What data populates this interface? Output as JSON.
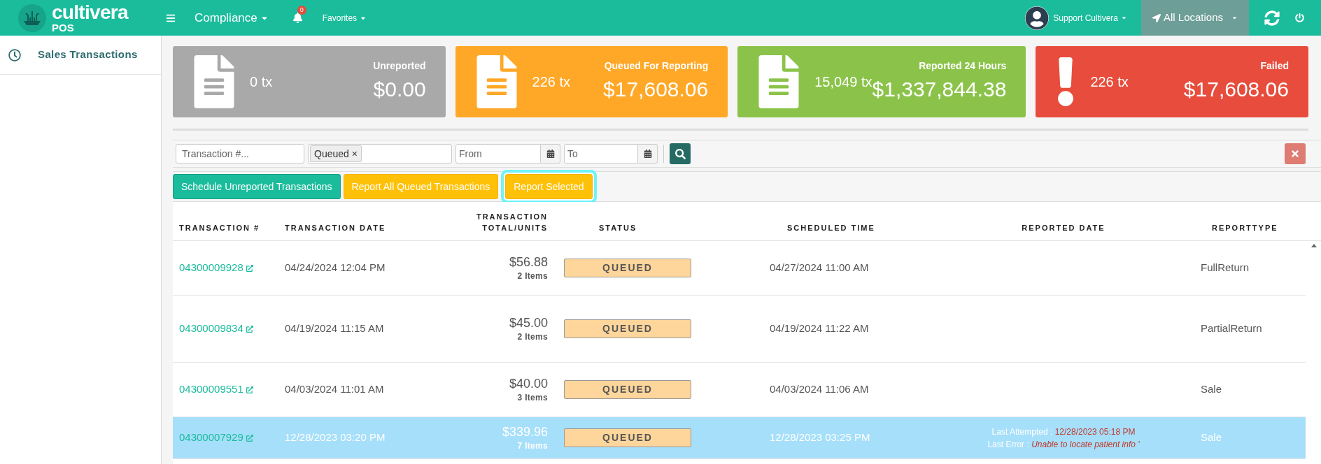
{
  "topbar": {
    "brand": "cultivera",
    "brand_sub": "POS",
    "menu": "Compliance",
    "notifications": "0",
    "favorites": "Favorites",
    "user": "Support Cultivera",
    "location": "All Locations"
  },
  "sidebar": {
    "items": [
      {
        "label": "Sales Transactions",
        "selected": true
      }
    ]
  },
  "cards": [
    {
      "label": "Unreported",
      "count": "0 tx",
      "amount": "$0.00",
      "kind": "document",
      "color": "#a9a9a9"
    },
    {
      "label": "Queued For Reporting",
      "count": "226 tx",
      "amount": "$17,608.06",
      "kind": "document",
      "color": "#ffa726"
    },
    {
      "label": "Reported 24 Hours",
      "count": "15,049 tx",
      "amount": "$1,337,844.38",
      "kind": "document",
      "color": "#8bc34a"
    },
    {
      "label": "Failed",
      "count": "226 tx",
      "amount": "$17,608.06",
      "kind": "alert",
      "color": "#e74c3c"
    }
  ],
  "filters": {
    "transaction_placeholder": "Transaction #...",
    "status_tag": "Queued",
    "tag_remove": "×",
    "from_placeholder": "From",
    "to_placeholder": "To"
  },
  "actions": [
    {
      "label": "Schedule Unreported Transactions",
      "kind": "primary",
      "focused": false
    },
    {
      "label": "Report All Queued Transactions",
      "kind": "warning",
      "focused": false
    },
    {
      "label": "Report Selected",
      "kind": "warning",
      "focused": true
    }
  ],
  "table": {
    "columns": [
      "TRANSACTION #",
      "TRANSACTION DATE",
      "TRANSACTION TOTAL/UNITS",
      "STATUS",
      "SCHEDULED TIME",
      "REPORTED DATE",
      "REPORTTYPE"
    ],
    "rows": [
      {
        "transaction": "04300009928",
        "date": "04/24/2024 12:04 PM",
        "total": "$56.88",
        "units": "2 Items",
        "status": "QUEUED",
        "scheduled": "04/27/2024 11:00 AM",
        "report_type": "FullReturn",
        "selected": false
      },
      {
        "transaction": "04300009834",
        "date": "04/19/2024 11:15 AM",
        "total": "$45.00",
        "units": "2 Items",
        "status": "QUEUED",
        "scheduled": "04/19/2024 11:22 AM",
        "report_type": "PartialReturn",
        "selected": false
      },
      {
        "transaction": "04300009551",
        "date": "04/03/2024 11:01 AM",
        "total": "$40.00",
        "units": "3 Items",
        "status": "QUEUED",
        "scheduled": "04/03/2024 11:06 AM",
        "report_type": "Sale",
        "selected": false
      },
      {
        "transaction": "04300007929",
        "date": "12/28/2023 03:20 PM",
        "total": "$339.96",
        "units": "7 Items",
        "status": "QUEUED",
        "scheduled": "12/28/2023 03:25 PM",
        "report_type": "Sale",
        "selected": true,
        "last_attempted_label": "Last Attempted :",
        "last_attempted": "12/28/2023 05:18 PM",
        "last_error_label": "Last Error :",
        "last_error": "Unable to locate patient info '"
      }
    ]
  }
}
